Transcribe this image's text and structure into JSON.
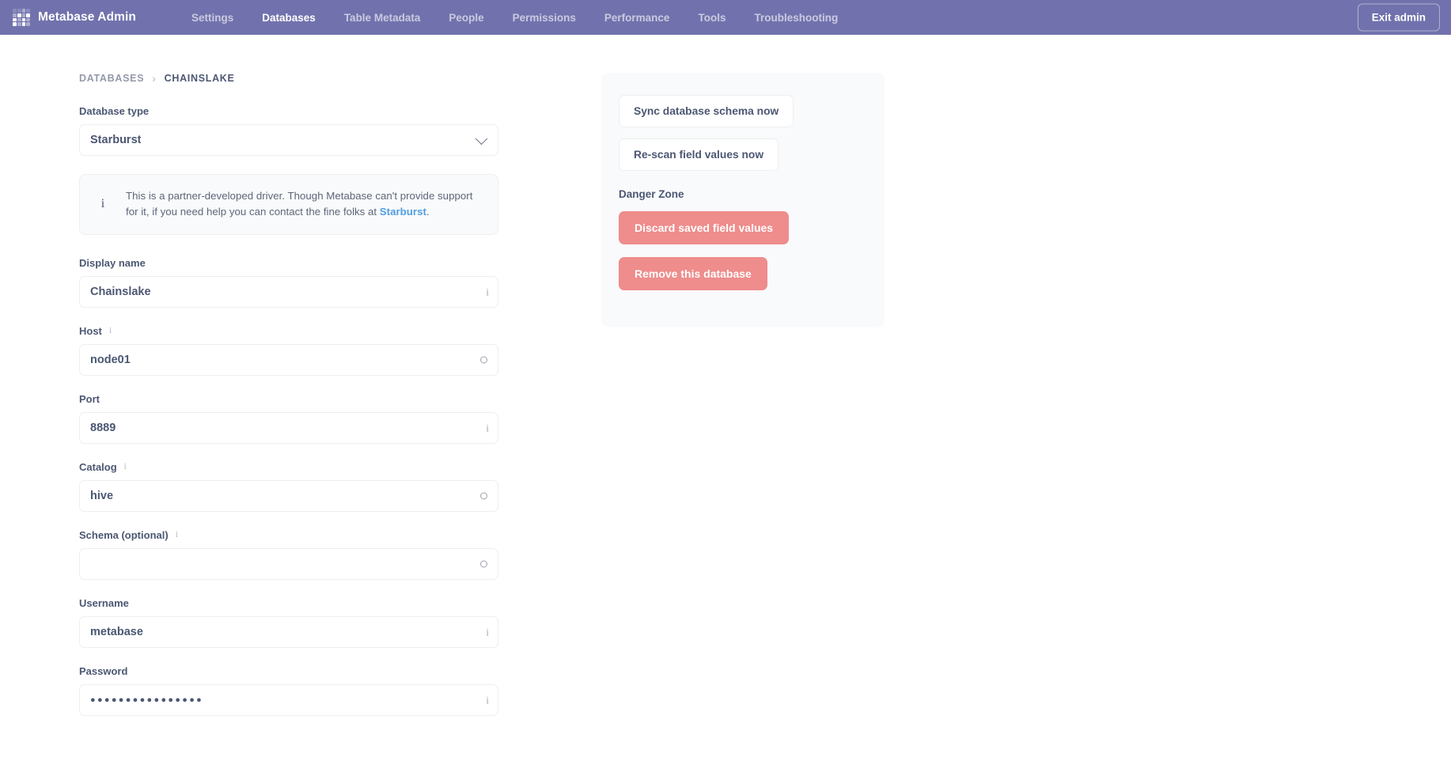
{
  "nav": {
    "brand": "Metabase Admin",
    "logo_icon": "metabase-dots-logo",
    "links": [
      {
        "label": "Settings",
        "active": false
      },
      {
        "label": "Databases",
        "active": true
      },
      {
        "label": "Table Metadata",
        "active": false
      },
      {
        "label": "People",
        "active": false
      },
      {
        "label": "Permissions",
        "active": false
      },
      {
        "label": "Performance",
        "active": false
      },
      {
        "label": "Tools",
        "active": false
      },
      {
        "label": "Troubleshooting",
        "active": false
      }
    ],
    "exit_admin": "Exit admin",
    "background_color": "#7172AD"
  },
  "breadcrumb": {
    "parent": "DATABASES",
    "separator": "›",
    "current": "CHAINSLAKE"
  },
  "form": {
    "database_type": {
      "label": "Database type",
      "value": "Starburst",
      "adornment": "chevron-down-icon"
    },
    "callout": {
      "icon": "info-icon",
      "text_before_link": "This is a partner-developed driver. Though Metabase can't provide support for it, if you need help you can contact the fine folks at ",
      "link": "Starburst",
      "text_after_link": ".",
      "link_color": "#509EE3"
    },
    "fields": [
      {
        "label": "Display name",
        "has_label_info": false,
        "value": "Chainslake",
        "placeholder": "",
        "adornment": "info-icon",
        "masked": false
      },
      {
        "label": "Host",
        "has_label_info": true,
        "value": "node01",
        "placeholder": "",
        "adornment": "circle-icon",
        "masked": false
      },
      {
        "label": "Port",
        "has_label_info": false,
        "value": "8889",
        "placeholder": "",
        "adornment": "info-icon",
        "masked": false
      },
      {
        "label": "Catalog",
        "has_label_info": true,
        "value": "hive",
        "placeholder": "",
        "adornment": "circle-icon",
        "masked": false
      },
      {
        "label": "Schema (optional)",
        "has_label_info": true,
        "value": "",
        "placeholder": "",
        "adornment": "circle-icon",
        "masked": false
      },
      {
        "label": "Username",
        "has_label_info": false,
        "value": "metabase",
        "placeholder": "",
        "adornment": "info-icon",
        "masked": false
      },
      {
        "label": "Password",
        "has_label_info": false,
        "value": "●●●●●●●●●●●●●●●●",
        "placeholder": "",
        "adornment": "info-icon",
        "masked": true
      }
    ],
    "label_info_icon": "info-icon"
  },
  "sidebar": {
    "sync_button": "Sync database schema now",
    "rescan_button": "Re-scan field values now",
    "danger_zone_title": "Danger Zone",
    "discard_button": "Discard saved field values",
    "remove_button": "Remove this database",
    "danger_color": "#EF8C8C"
  }
}
